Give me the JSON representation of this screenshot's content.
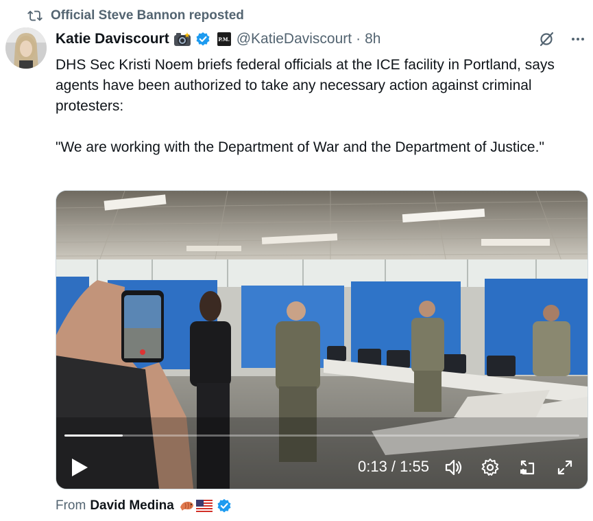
{
  "repost": {
    "label": "Official Steve Bannon reposted",
    "icon": "repost-icon"
  },
  "author": {
    "name": "Katie Daviscourt",
    "handle": "@KatieDaviscourt",
    "separator": "·",
    "time": "8h",
    "affiliation_badge_text": "P.M.",
    "verified": true
  },
  "tweet": {
    "paragraphs": [
      "DHS Sec Kristi Noem briefs federal officials at the ICE facility in Portland, says agents have been authorized to take any necessary action against criminal protesters:",
      "\"We are working with the Department of War and the Department of Justice.\""
    ]
  },
  "video": {
    "current_time": "0:13",
    "duration": "1:55",
    "time_display": "0:13 / 1:55",
    "progress": 0.113
  },
  "attribution": {
    "prefix": "From",
    "name": "David Medina",
    "verified": true
  },
  "colors": {
    "text_primary": "#0f1419",
    "text_secondary": "#536471",
    "verified_blue": "#1d9bf0",
    "media_border": "#cfd9de"
  }
}
